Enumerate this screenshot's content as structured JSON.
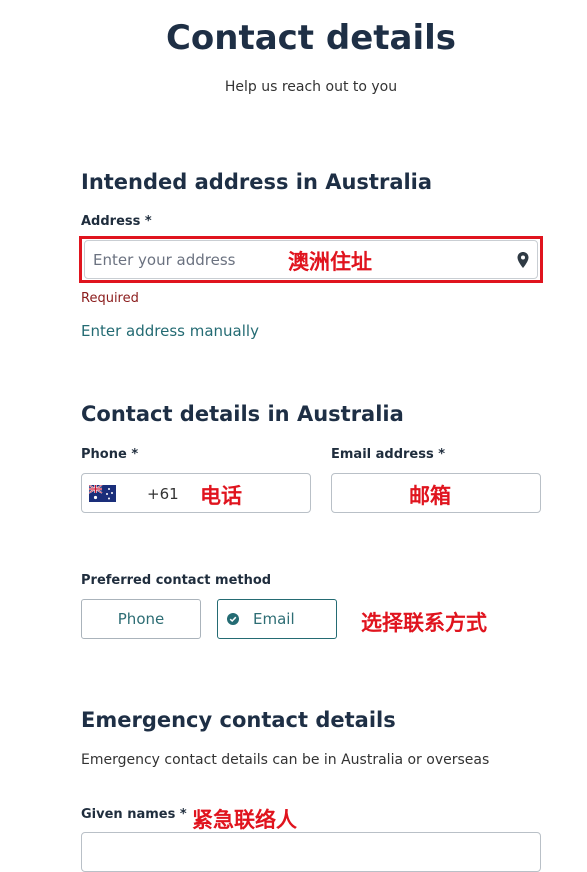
{
  "header": {
    "title": "Contact details",
    "subtitle": "Help us reach out to you"
  },
  "address_section": {
    "heading": "Intended address in Australia",
    "address_label": "Address",
    "required_mark": "*",
    "address_placeholder": "Enter your address",
    "address_annotation": "澳洲住址",
    "error_text": "Required",
    "manual_link": "Enter address manually"
  },
  "contact_section": {
    "heading": "Contact details in Australia",
    "phone_label": "Phone",
    "email_label": "Email address",
    "required_mark": "*",
    "phone_code": "+61",
    "phone_annotation": "电话",
    "email_annotation": "邮箱",
    "preferred_label": "Preferred contact method",
    "method_options": [
      "Phone",
      "Email"
    ],
    "selected_method": "Email",
    "method_annotation": "选择联系方式"
  },
  "emergency_section": {
    "heading": "Emergency contact details",
    "helper_text": "Emergency contact details can be in Australia or overseas",
    "given_names_label": "Given names",
    "required_mark": "*",
    "given_names_annotation": "紧急联络人"
  },
  "colors": {
    "heading": "#1e2f45",
    "accent_teal": "#246b73",
    "error": "#8b1c1c",
    "annotation_red": "#e0141e"
  },
  "icons": {
    "location": "map-pin-icon",
    "flag": "australia-flag-icon",
    "selected": "check-circle-icon"
  }
}
